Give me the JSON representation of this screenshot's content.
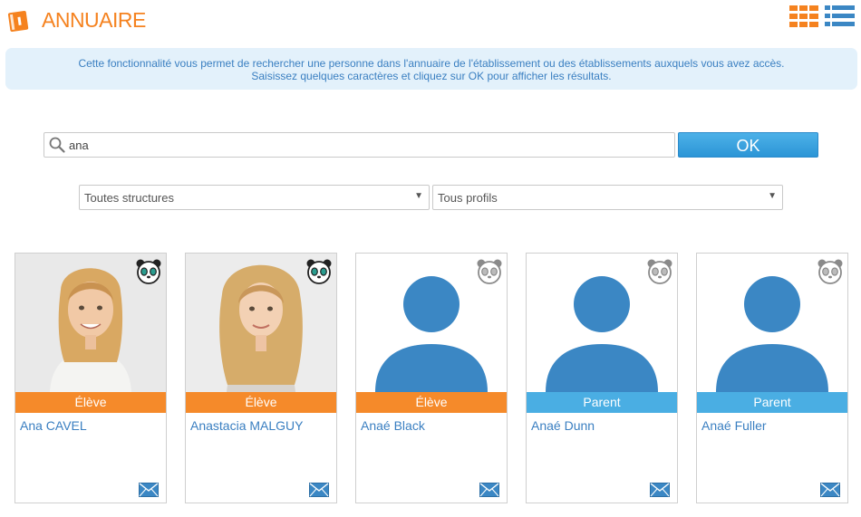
{
  "header": {
    "title": "ANNUAIRE"
  },
  "info": {
    "line1": "Cette fonctionnalité vous permet de rechercher une personne dans l'annuaire de l'établissement ou des établissements auxquels vous avez accès.",
    "line2": "Saisissez quelques caractères et cliquez sur OK pour afficher les résultats."
  },
  "search": {
    "value": "ana",
    "button_label": "OK"
  },
  "filters": {
    "structure": "Toutes structures",
    "profile": "Tous profils"
  },
  "colors": {
    "accent": "#f5821f",
    "eleve": "#f58a2a",
    "parent": "#4aaee3",
    "avatar": "#3b87c4"
  },
  "results": [
    {
      "name": "Ana CAVEL",
      "profile": "Élève",
      "photo": "photo",
      "panda_active": true
    },
    {
      "name": "Anastacia MALGUY",
      "profile": "Élève",
      "photo": "photo",
      "panda_active": true
    },
    {
      "name": "Anaé Black",
      "profile": "Élève",
      "photo": "avatar",
      "panda_active": false
    },
    {
      "name": "Anaé Dunn",
      "profile": "Parent",
      "photo": "avatar",
      "panda_active": false
    },
    {
      "name": "Anaé Fuller",
      "profile": "Parent",
      "photo": "avatar",
      "panda_active": false
    }
  ]
}
